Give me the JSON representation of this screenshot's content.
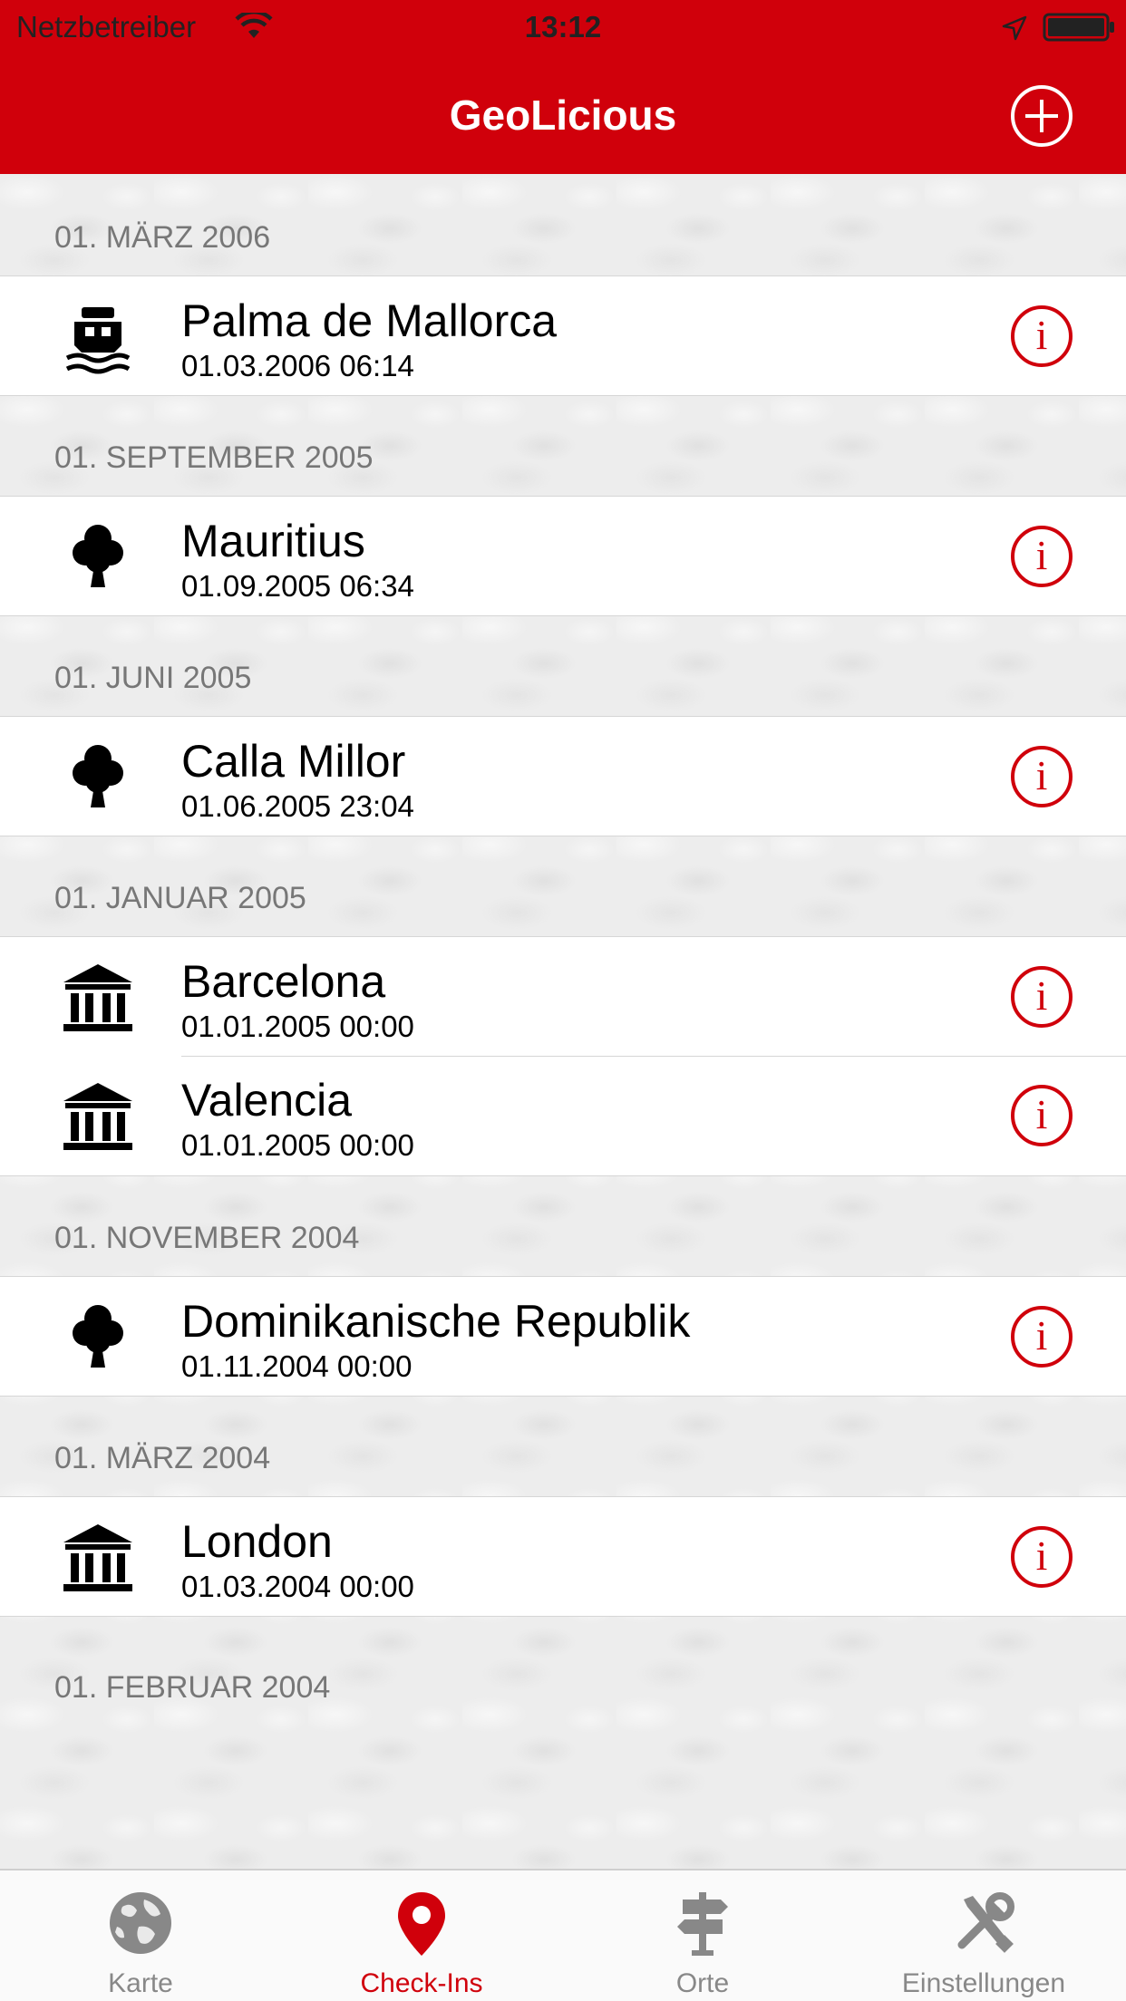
{
  "status_bar": {
    "carrier": "Netzbetreiber",
    "time": "13:12"
  },
  "nav": {
    "title": "GeoLicious",
    "add_icon": "plus-circle-icon"
  },
  "colors": {
    "accent": "#d0000b",
    "section_text": "#777777"
  },
  "sections": [
    {
      "header": "01. MÄRZ 2006",
      "items": [
        {
          "icon": "ship-icon",
          "title": "Palma de Mallorca",
          "date": "01.03.2006 06:14"
        }
      ]
    },
    {
      "header": "01. SEPTEMBER 2005",
      "items": [
        {
          "icon": "tree-icon",
          "title": "Mauritius",
          "date": "01.09.2005 06:34"
        }
      ]
    },
    {
      "header": "01. JUNI 2005",
      "items": [
        {
          "icon": "tree-icon",
          "title": "Calla Millor",
          "date": "01.06.2005 23:04"
        }
      ]
    },
    {
      "header": "01. JANUAR 2005",
      "items": [
        {
          "icon": "museum-icon",
          "title": "Barcelona",
          "date": "01.01.2005 00:00"
        },
        {
          "icon": "museum-icon",
          "title": "Valencia",
          "date": "01.01.2005 00:00"
        }
      ]
    },
    {
      "header": "01. NOVEMBER 2004",
      "items": [
        {
          "icon": "tree-icon",
          "title": "Dominikanische Republik",
          "date": "01.11.2004 00:00"
        }
      ]
    },
    {
      "header": "01. MÄRZ 2004",
      "items": [
        {
          "icon": "museum-icon",
          "title": "London",
          "date": "01.03.2004 00:00"
        }
      ]
    },
    {
      "header": "01. FEBRUAR 2004",
      "items": []
    }
  ],
  "tabs": [
    {
      "label": "Karte",
      "icon": "globe-icon",
      "active": false
    },
    {
      "label": "Check-Ins",
      "icon": "map-pin-icon",
      "active": true
    },
    {
      "label": "Orte",
      "icon": "signpost-icon",
      "active": false
    },
    {
      "label": "Einstellungen",
      "icon": "tools-icon",
      "active": false
    }
  ]
}
